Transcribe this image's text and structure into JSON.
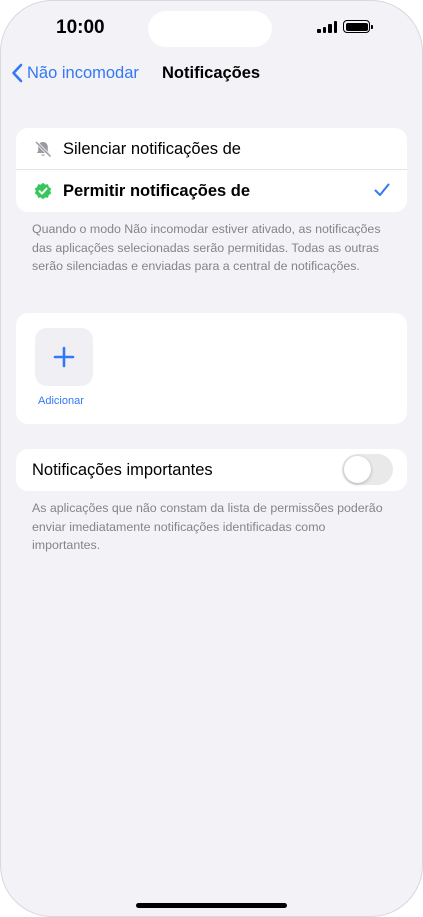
{
  "status_bar": {
    "time": "10:00",
    "battery_level": 1.0
  },
  "nav": {
    "back_label": "Não incomodar",
    "title": "Notificações"
  },
  "notification_mode": {
    "options": [
      {
        "label": "Silenciar notificações de",
        "icon": "bell-slash-icon",
        "selected": false
      },
      {
        "label": "Permitir notificações de",
        "icon": "verified-badge-icon",
        "selected": true
      }
    ],
    "footnote": "Quando o modo Não incomodar estiver ativado, as notificações das aplicações selecionadas serão permitidas. Todas as outras serão silenciadas e enviadas para a central de notificações."
  },
  "apps": {
    "add_label": "Adicionar"
  },
  "important": {
    "label": "Notificações importantes",
    "enabled": false,
    "footnote": "As aplicações que não constam da lista de permissões poderão enviar imediatamente notificações identificadas como importantes."
  },
  "colors": {
    "accent": "#3478f6",
    "badge_green": "#35c759",
    "background": "#f2f2f7"
  }
}
